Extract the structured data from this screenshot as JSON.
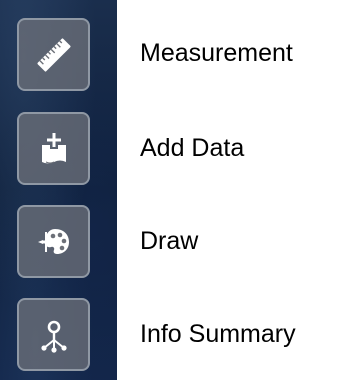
{
  "toolbar": {
    "items": [
      {
        "label": "Measurement",
        "icon": "ruler-icon"
      },
      {
        "label": "Add Data",
        "icon": "add-data-icon"
      },
      {
        "label": "Draw",
        "icon": "palette-icon"
      },
      {
        "label": "Info Summary",
        "icon": "info-summary-icon"
      }
    ]
  },
  "colors": {
    "background": "#ffffff",
    "map_strip": "#13264a",
    "button_fill": "#6c7078",
    "button_border": "#8f98a4",
    "icon": "#ffffff",
    "label_text": "#000000"
  }
}
